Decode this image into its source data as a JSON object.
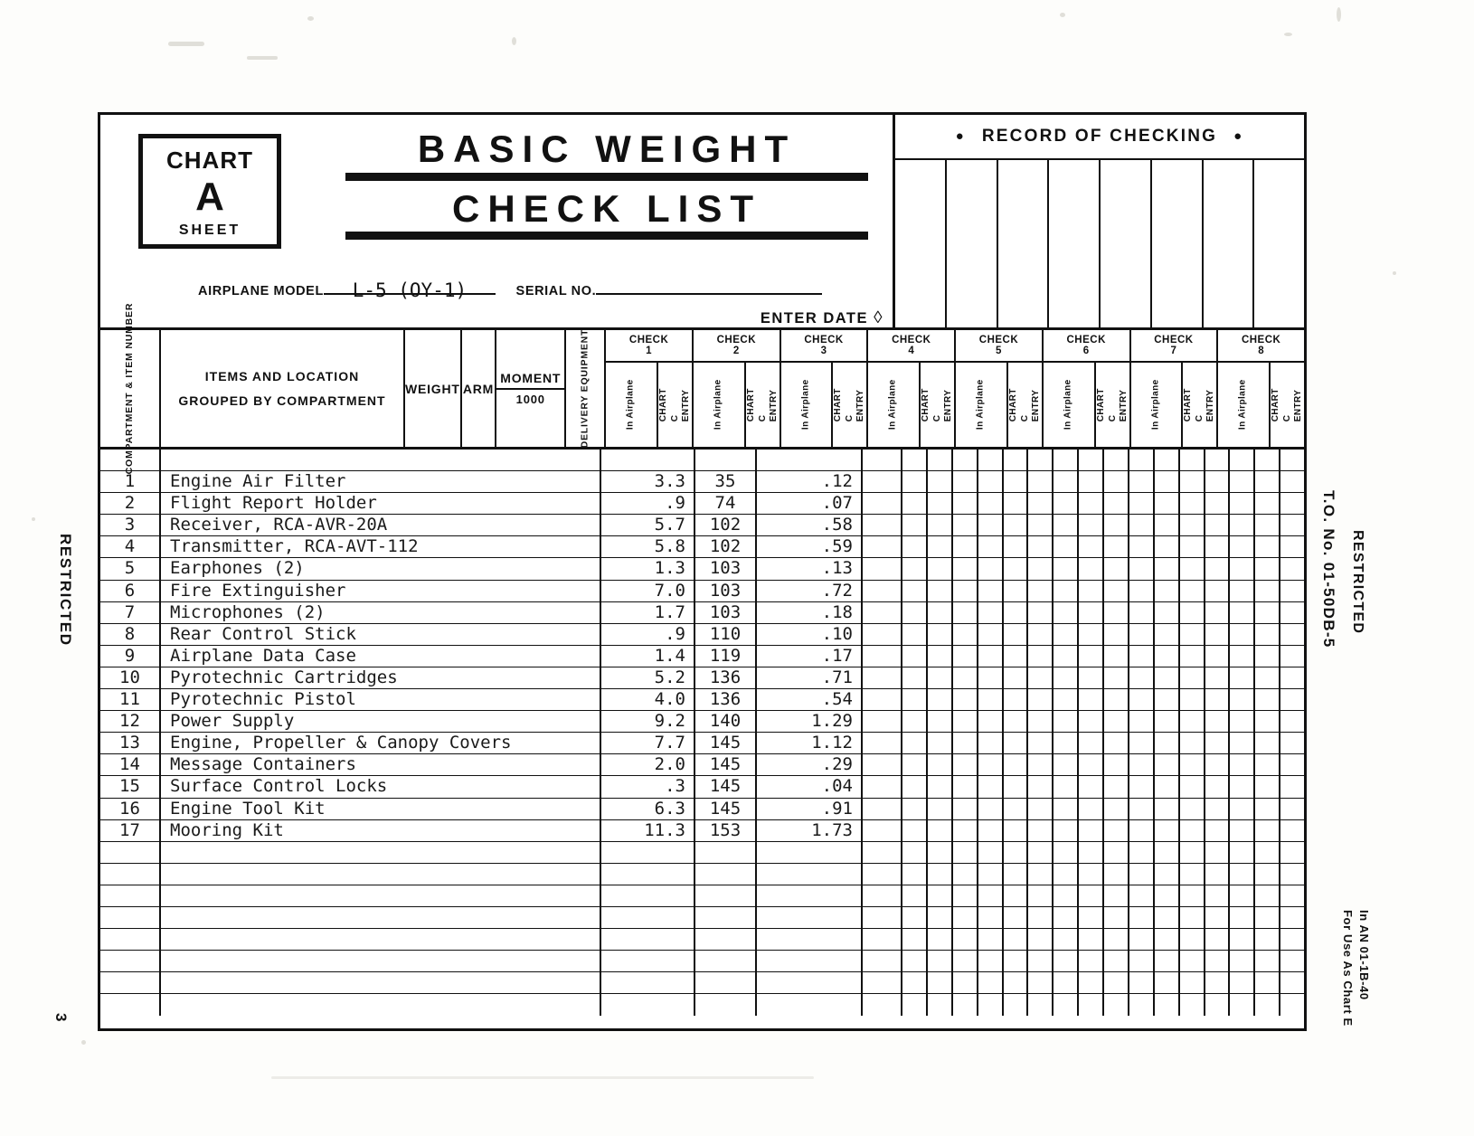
{
  "page": {
    "left_margin_text": "RESTRICTED",
    "page_number": "3",
    "right_margin_restricted": "RESTRICTED",
    "right_margin_to_number": "T.O. No. 01-50DB-5",
    "right_margin_note_line1": "For Use As Chart E",
    "right_margin_note_line2": "In AN 01-1B-40"
  },
  "header": {
    "chart_box": {
      "chart_label": "CHART",
      "letter": "A",
      "sheet_label": "SHEET"
    },
    "title_line1": "BASIC WEIGHT",
    "title_line2": "CHECK LIST",
    "airplane_model_label": "AIRPLANE MODEL",
    "airplane_model_value": "L-5 (OY-1)",
    "serial_no_label": "SERIAL NO.",
    "serial_no_value": "",
    "enter_date_label": "ENTER DATE",
    "enter_date_glyph": "◊",
    "record_of_checking": "RECORD OF CHECKING",
    "bullet_glyph": "●"
  },
  "columns": {
    "compartment_item_number": "COMPARTMENT & ITEM NUMBER",
    "items_line1": "ITEMS AND LOCATION",
    "items_line2": "GROUPED BY COMPARTMENT",
    "weight": "WEIGHT",
    "arm": "ARM",
    "moment_top": "MOMENT",
    "moment_bottom": "1000",
    "delivery_equipment": "DELIVERY EQUIPMENT",
    "check_word": "CHECK",
    "check_numbers": [
      "1",
      "2",
      "3",
      "4",
      "5",
      "6",
      "7",
      "8"
    ],
    "sub_in_airplane": "In Airplane",
    "sub_chart_c_entry": "CHART C ENTRY"
  },
  "chart_data": {
    "type": "table",
    "title": "BASIC WEIGHT CHECK LIST",
    "columns": [
      "Item No.",
      "Items and Location Grouped by Compartment",
      "Weight",
      "Arm",
      "Moment/1000"
    ],
    "rows": [
      {
        "no": "1",
        "item": "Engine Air Filter",
        "weight": "3.3",
        "arm": "35",
        "moment": ".12"
      },
      {
        "no": "2",
        "item": "Flight Report Holder",
        "weight": ".9",
        "arm": "74",
        "moment": ".07"
      },
      {
        "no": "3",
        "item": "Receiver, RCA-AVR-20A",
        "weight": "5.7",
        "arm": "102",
        "moment": ".58"
      },
      {
        "no": "4",
        "item": "Transmitter, RCA-AVT-112",
        "weight": "5.8",
        "arm": "102",
        "moment": ".59"
      },
      {
        "no": "5",
        "item": "Earphones (2)",
        "weight": "1.3",
        "arm": "103",
        "moment": ".13"
      },
      {
        "no": "6",
        "item": "Fire Extinguisher",
        "weight": "7.0",
        "arm": "103",
        "moment": ".72"
      },
      {
        "no": "7",
        "item": "Microphones (2)",
        "weight": "1.7",
        "arm": "103",
        "moment": ".18"
      },
      {
        "no": "8",
        "item": "Rear Control Stick",
        "weight": ".9",
        "arm": "110",
        "moment": ".10"
      },
      {
        "no": "9",
        "item": "Airplane Data Case",
        "weight": "1.4",
        "arm": "119",
        "moment": ".17"
      },
      {
        "no": "10",
        "item": "Pyrotechnic Cartridges",
        "weight": "5.2",
        "arm": "136",
        "moment": ".71"
      },
      {
        "no": "11",
        "item": "Pyrotechnic Pistol",
        "weight": "4.0",
        "arm": "136",
        "moment": ".54"
      },
      {
        "no": "12",
        "item": "Power Supply",
        "weight": "9.2",
        "arm": "140",
        "moment": "1.29"
      },
      {
        "no": "13",
        "item": "Engine, Propeller & Canopy Covers",
        "weight": "7.7",
        "arm": "145",
        "moment": "1.12"
      },
      {
        "no": "14",
        "item": "Message Containers",
        "weight": "2.0",
        "arm": "145",
        "moment": ".29"
      },
      {
        "no": "15",
        "item": "Surface Control Locks",
        "weight": ".3",
        "arm": "145",
        "moment": ".04"
      },
      {
        "no": "16",
        "item": "Engine Tool Kit",
        "weight": "6.3",
        "arm": "145",
        "moment": ".91"
      },
      {
        "no": "17",
        "item": "Mooring Kit",
        "weight": "11.3",
        "arm": "153",
        "moment": "1.73"
      }
    ],
    "blank_rows_before": 1,
    "blank_rows_after": 8
  }
}
